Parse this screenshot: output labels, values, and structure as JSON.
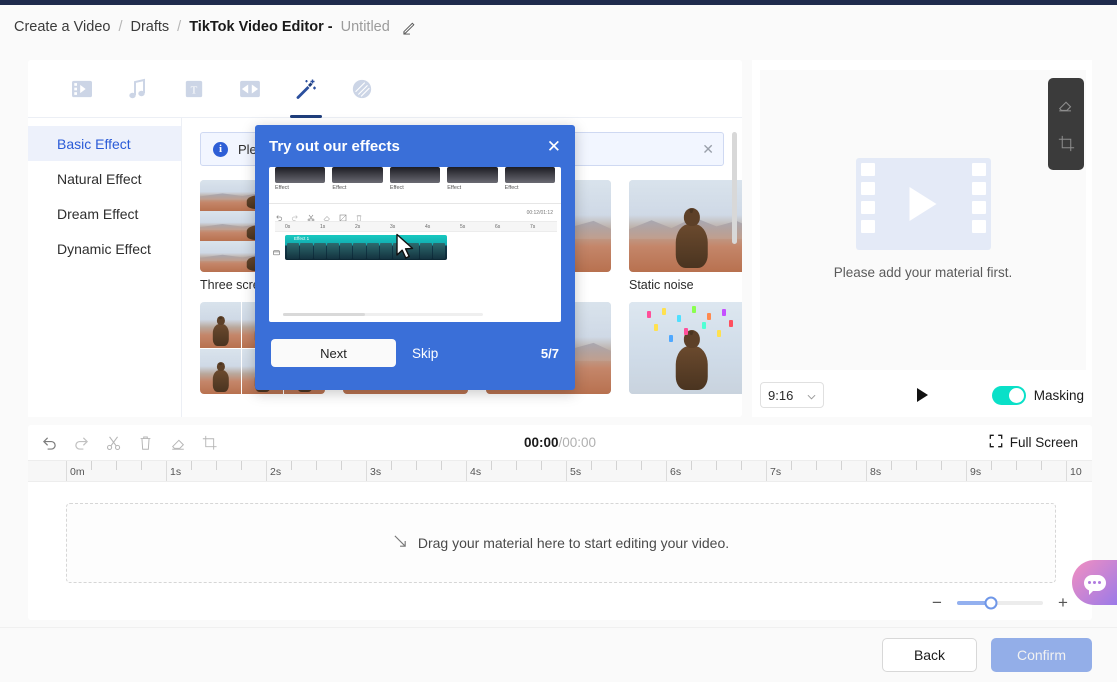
{
  "breadcrumb": {
    "root": "Create a Video",
    "sep": "/",
    "drafts": "Drafts",
    "current": "TikTok Video Editor -",
    "untitled": "Untitled",
    "edit_icon": "pencil-icon"
  },
  "tabs": [
    {
      "name": "video",
      "icon": "film-icon",
      "active": false
    },
    {
      "name": "audio",
      "icon": "music-note-icon",
      "active": false
    },
    {
      "name": "text",
      "icon": "text-box-icon",
      "active": false
    },
    {
      "name": "transition",
      "icon": "transition-icon",
      "active": false
    },
    {
      "name": "effect",
      "icon": "magic-wand-icon",
      "active": true
    },
    {
      "name": "filter",
      "icon": "filter-layers-icon",
      "active": false
    }
  ],
  "categories": [
    {
      "label": "Basic Effect",
      "active": true
    },
    {
      "label": "Natural Effect",
      "active": false
    },
    {
      "label": "Dream Effect",
      "active": false
    },
    {
      "label": "Dynamic Effect",
      "active": false
    }
  ],
  "info_banner": {
    "icon": "info-icon",
    "text": "Please",
    "close_icon": "close-icon"
  },
  "effects": [
    {
      "label": "Three screen s",
      "style": "split3"
    },
    {
      "label": "",
      "style": "plain"
    },
    {
      "label": "",
      "style": "plain"
    },
    {
      "label": "Static noise",
      "style": "noise"
    },
    {
      "label": "",
      "style": "grid4"
    },
    {
      "label": "",
      "style": "plain"
    },
    {
      "label": "",
      "style": "plain"
    },
    {
      "label": "",
      "style": "confetti"
    }
  ],
  "preview": {
    "placeholder_icon": "film-play-icon",
    "message": "Please add your material first.",
    "tools": [
      {
        "name": "eraser-icon"
      },
      {
        "name": "crop-icon"
      }
    ],
    "ratio": "9:16",
    "ratio_caret": "chevron-down-icon",
    "play_icon": "play-icon",
    "masking_label": "Masking",
    "masking_on": true,
    "accent_teal": "#0ae0c8"
  },
  "timeline": {
    "tools": [
      {
        "name": "undo-icon"
      },
      {
        "name": "redo-icon"
      },
      {
        "name": "scissors-icon"
      },
      {
        "name": "trash-icon"
      },
      {
        "name": "eraser-icon"
      },
      {
        "name": "crop-icon"
      }
    ],
    "current_time": "00:00",
    "time_sep": "/",
    "total_time": "00:00",
    "fullscreen_label": "Full Screen",
    "fullscreen_icon": "expand-icon",
    "ruler_labels": [
      "0m",
      "1s",
      "2s",
      "3s",
      "4s",
      "5s",
      "6s",
      "7s",
      "8s",
      "9s",
      "10"
    ],
    "dropzone_icon": "arrow-down-right-icon",
    "dropzone_text": "Drag your material here to start editing your video.",
    "zoom_out_icon": "minus-icon",
    "zoom_in_icon": "plus-icon",
    "zoom_value": 40
  },
  "bottom": {
    "back_label": "Back",
    "confirm_label": "Confirm",
    "confirm_disabled": true
  },
  "chat": {
    "icon": "chat-bubble-icon"
  },
  "modal": {
    "title": "Try out our effects",
    "close_icon": "close-icon",
    "next_label": "Next",
    "skip_label": "Skip",
    "step": "5/7",
    "illustration": {
      "effect_caps": [
        "Effect",
        "Effect",
        "Effect",
        "Effect",
        "Effect"
      ],
      "duration": "00:12/01:12",
      "ruler_labels": [
        "0s",
        "1s",
        "2s",
        "3s",
        "4s",
        "5s",
        "6s",
        "7s"
      ],
      "clip_label": "Effect 1",
      "cursor_icon": "cursor-arrow-icon"
    }
  },
  "colors": {
    "brand_blue": "#3a6fd8",
    "tab_active": "#1f3e7c",
    "category_active": "#2a5bd7",
    "teal": "#0ae0c8",
    "confirm": "#93aee8"
  }
}
